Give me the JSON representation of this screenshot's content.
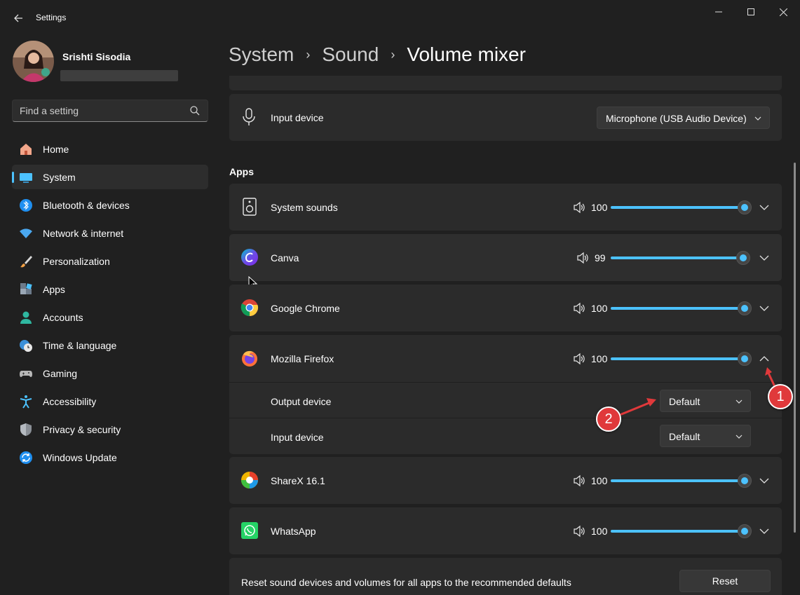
{
  "window": {
    "title": "Settings"
  },
  "user": {
    "name": "Srishti Sisodia"
  },
  "search": {
    "placeholder": "Find a setting"
  },
  "nav": [
    {
      "label": "Home",
      "icon": "home-icon"
    },
    {
      "label": "System",
      "icon": "system-icon",
      "active": true
    },
    {
      "label": "Bluetooth & devices",
      "icon": "bluetooth-icon"
    },
    {
      "label": "Network & internet",
      "icon": "wifi-icon"
    },
    {
      "label": "Personalization",
      "icon": "brush-icon"
    },
    {
      "label": "Apps",
      "icon": "apps-icon"
    },
    {
      "label": "Accounts",
      "icon": "accounts-icon"
    },
    {
      "label": "Time & language",
      "icon": "globe-clock-icon"
    },
    {
      "label": "Gaming",
      "icon": "gamepad-icon"
    },
    {
      "label": "Accessibility",
      "icon": "accessibility-icon"
    },
    {
      "label": "Privacy & security",
      "icon": "shield-icon"
    },
    {
      "label": "Windows Update",
      "icon": "update-icon"
    }
  ],
  "breadcrumb": {
    "item1": "System",
    "item2": "Sound",
    "current": "Volume mixer"
  },
  "input_device": {
    "label": "Input device",
    "value": "Microphone (USB Audio Device)"
  },
  "apps_section": {
    "title": "Apps"
  },
  "apps": [
    {
      "name": "System sounds",
      "volume": "100",
      "volume_level": 1.0,
      "expanded": false
    },
    {
      "name": "Canva",
      "volume": "99",
      "volume_level": 0.99,
      "expanded": false
    },
    {
      "name": "Google Chrome",
      "volume": "100",
      "volume_level": 1.0,
      "expanded": false
    },
    {
      "name": "Mozilla Firefox",
      "volume": "100",
      "volume_level": 1.0,
      "expanded": true,
      "output_device_label": "Output device",
      "output_device_value": "Default",
      "input_device_label": "Input device",
      "input_device_value": "Default"
    },
    {
      "name": "ShareX 16.1",
      "volume": "100",
      "volume_level": 1.0,
      "expanded": false
    },
    {
      "name": "WhatsApp",
      "volume": "100",
      "volume_level": 1.0,
      "expanded": false
    }
  ],
  "reset": {
    "text": "Reset sound devices and volumes for all apps to the recommended defaults",
    "button": "Reset"
  },
  "annotations": {
    "badge1": "1",
    "badge2": "2"
  },
  "colors": {
    "accent": "#4cc2ff",
    "background": "#202020",
    "card": "#2b2b2b",
    "badge": "#e0393b"
  }
}
